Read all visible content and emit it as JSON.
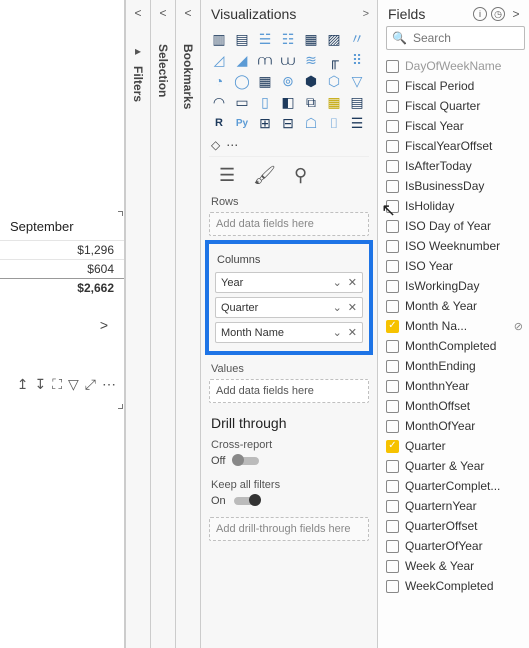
{
  "main": {
    "month_header": "September",
    "rows": [
      "$1,296",
      "$604",
      "$2,662"
    ],
    "expand_glyph": ">"
  },
  "panels": {
    "filters": "Filters",
    "selection": "Selection",
    "bookmarks": "Bookmarks",
    "chev": "<"
  },
  "viz": {
    "title": "Visualizations",
    "chev": ">",
    "rows_label": "Rows",
    "rows_placeholder": "Add data fields here",
    "columns_label": "Columns",
    "columns_fields": [
      {
        "name": "Year"
      },
      {
        "name": "Quarter"
      },
      {
        "name": "Month Name"
      }
    ],
    "pill_chev": "⌄",
    "pill_x": "✕",
    "values_label": "Values",
    "values_placeholder": "Add data fields here",
    "drill_title": "Drill through",
    "cross_report_label": "Cross-report",
    "off_label": "Off",
    "keep_filters_label": "Keep all filters",
    "on_label": "On",
    "drill_placeholder": "Add drill-through fields here"
  },
  "fields": {
    "title": "Fields",
    "search_placeholder": "Search",
    "items": [
      {
        "name": "DayOfWeekName",
        "checked": false,
        "clip": true
      },
      {
        "name": "Fiscal Period",
        "checked": false
      },
      {
        "name": "Fiscal Quarter",
        "checked": false
      },
      {
        "name": "Fiscal Year",
        "checked": false
      },
      {
        "name": "FiscalYearOffset",
        "checked": false
      },
      {
        "name": "IsAfterToday",
        "checked": false
      },
      {
        "name": "IsBusinessDay",
        "checked": false
      },
      {
        "name": "IsHoliday",
        "checked": false
      },
      {
        "name": "ISO Day of Year",
        "checked": false
      },
      {
        "name": "ISO Weeknumber",
        "checked": false
      },
      {
        "name": "ISO Year",
        "checked": false
      },
      {
        "name": "IsWorkingDay",
        "checked": false
      },
      {
        "name": "Month & Year",
        "checked": false
      },
      {
        "name": "Month Na...",
        "checked": true,
        "extra": "⊘"
      },
      {
        "name": "MonthCompleted",
        "checked": false
      },
      {
        "name": "MonthEnding",
        "checked": false
      },
      {
        "name": "MonthnYear",
        "checked": false
      },
      {
        "name": "MonthOffset",
        "checked": false
      },
      {
        "name": "MonthOfYear",
        "checked": false
      },
      {
        "name": "Quarter",
        "checked": true
      },
      {
        "name": "Quarter & Year",
        "checked": false
      },
      {
        "name": "QuarterComplet...",
        "checked": false
      },
      {
        "name": "QuarternYear",
        "checked": false
      },
      {
        "name": "QuarterOffset",
        "checked": false
      },
      {
        "name": "QuarterOfYear",
        "checked": false
      },
      {
        "name": "Week & Year",
        "checked": false
      },
      {
        "name": "WeekCompleted",
        "checked": false
      }
    ]
  },
  "glyphs": {
    "info": "i",
    "clock": "◷",
    "collapse": ">"
  }
}
